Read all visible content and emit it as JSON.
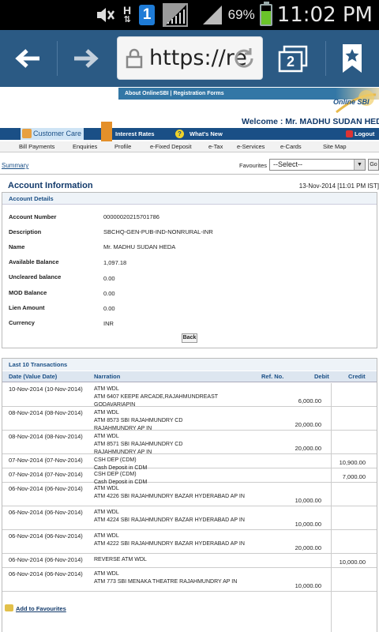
{
  "status_bar": {
    "time": "11:02 PM",
    "battery_pct": "69%",
    "battery_level": 0.69,
    "net_type": "H",
    "notif_badge": "1"
  },
  "browser": {
    "url": "https://re",
    "tabs_count": "2"
  },
  "header": {
    "top_links": "About OnlineSBI | Registration Forms",
    "logo_text": "Online SBI",
    "welcome": "Welcome : Mr. MADHU SUDAN HEDA",
    "customer_care": "Customer Care",
    "interest_rates": "Interest Rates",
    "whats_new": "What's New",
    "logout": "Logout"
  },
  "menu": [
    "Bill Payments",
    "Enquiries",
    "Profile",
    "e-Fixed Deposit",
    "e-Tax",
    "e-Services",
    "e-Cards",
    "Site Map"
  ],
  "breadcrumb": {
    "summary": "Summary"
  },
  "favourites": {
    "label": "Favourites",
    "selected": "--Select--",
    "go": "Go"
  },
  "account_info": {
    "title": "Account Information",
    "datetime": "13-Nov-2014 [11:01 PM IST]",
    "section": "Account Details",
    "fields": [
      {
        "label": "Account Number",
        "value": "00000020215701786"
      },
      {
        "label": "Description",
        "value": "SBCHQ-GEN-PUB-IND-NONRURAL-INR"
      },
      {
        "label": "Name",
        "value": "Mr. MADHU SUDAN HEDA"
      },
      {
        "label": "Available Balance",
        "value": "1,097.18"
      },
      {
        "label": "Uncleared balance",
        "value": "0.00"
      },
      {
        "label": "MOD Balance",
        "value": "0.00"
      },
      {
        "label": "Lien Amount",
        "value": "0.00"
      },
      {
        "label": "Currency",
        "value": "INR"
      }
    ],
    "back": "Back"
  },
  "transactions": {
    "title": "Last 10 Transactions",
    "columns": {
      "date": "Date (Value Date)",
      "narration": "Narration",
      "ref": "Ref. No.",
      "debit": "Debit",
      "credit": "Credit"
    },
    "rows": [
      {
        "date": "10-Nov-2014 (10-Nov-2014)",
        "narration": "ATM WDL\nATM 6407 KEEPE ARCADE,RAJAHMUNDREAST GODAVARIAPIN",
        "debit": "6,000.00",
        "credit": ""
      },
      {
        "date": "08-Nov-2014 (08-Nov-2014)",
        "narration": "ATM WDL\nATM 8573 SBI RAJAHMUNDRY CD\nRAJAHMUNDRY AP IN",
        "debit": "20,000.00",
        "credit": ""
      },
      {
        "date": "08-Nov-2014 (08-Nov-2014)",
        "narration": "ATM WDL\nATM 8571 SBI RAJAHMUNDRY CD\nRAJAHMUNDRY AP IN",
        "debit": "20,000.00",
        "credit": ""
      },
      {
        "date": "07-Nov-2014 (07-Nov-2014)",
        "narration": "CSH DEP (CDM)\nCash Deposit in CDM",
        "debit": "",
        "credit": "10,900.00"
      },
      {
        "date": "07-Nov-2014 (07-Nov-2014)",
        "narration": "CSH DEP (CDM)\nCash Deposit in CDM",
        "debit": "",
        "credit": "7,000.00"
      },
      {
        "date": "06-Nov-2014 (06-Nov-2014)",
        "narration": "ATM WDL\nATM 4226 SBI RAJAHMUNDRY BAZAR HYDERABAD AP IN",
        "debit": "10,000.00",
        "credit": ""
      },
      {
        "date": "06-Nov-2014 (06-Nov-2014)",
        "narration": "ATM WDL\nATM 4224 SBI RAJAHMUNDRY BAZAR HYDERABAD AP IN",
        "debit": "10,000.00",
        "credit": ""
      },
      {
        "date": "06-Nov-2014 (06-Nov-2014)",
        "narration": "ATM WDL\nATM 4222 SBI RAJAHMUNDRY BAZAR HYDERABAD AP IN",
        "debit": "20,000.00",
        "credit": ""
      },
      {
        "date": "06-Nov-2014 (06-Nov-2014)",
        "narration": "REVERSE ATM WDL",
        "debit": "",
        "credit": "10,000.00"
      },
      {
        "date": "06-Nov-2014 (06-Nov-2014)",
        "narration": "ATM WDL\nATM 773 SBI MENAKA THEATRE RAJAHMUNDRY AP IN",
        "debit": "10,000.00",
        "credit": ""
      }
    ]
  },
  "footer": {
    "add_favourites": "Add to Favourites"
  }
}
